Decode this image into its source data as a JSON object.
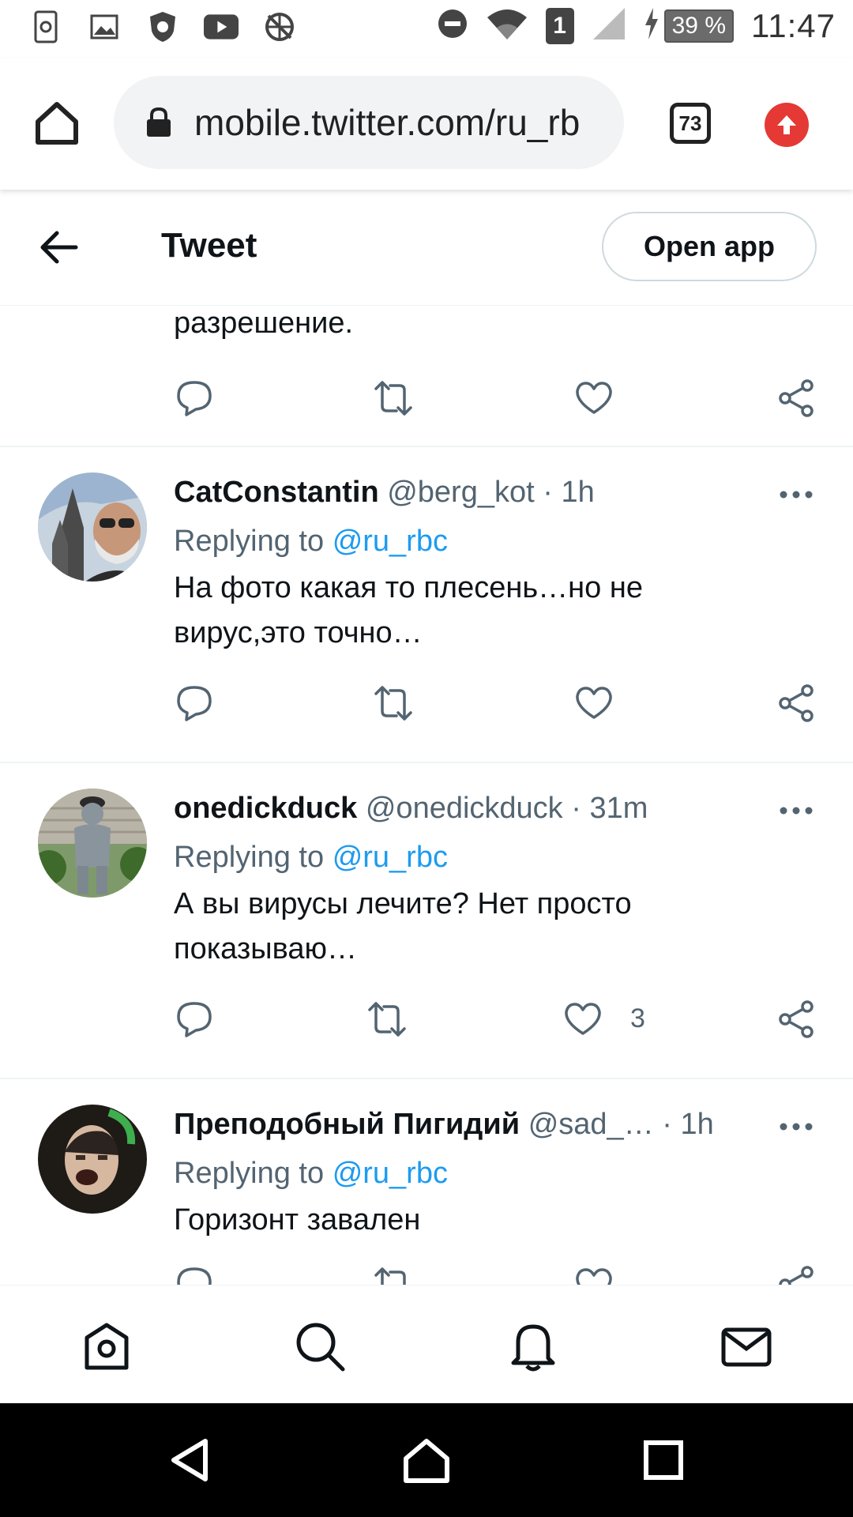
{
  "status_bar": {
    "sim_slot": "1",
    "battery": "39 %",
    "time": "11:47"
  },
  "browser": {
    "url": "mobile.twitter.com/ru_rb",
    "tab_count": "73"
  },
  "header": {
    "title": "Tweet",
    "open_app": "Open app"
  },
  "feed": {
    "partial_text": "разрешение.",
    "tweets": [
      {
        "name": "CatConstantin",
        "meta": "@berg_kot · 1h",
        "replying_prefix": "Replying to",
        "replying_to": "@ru_rbc",
        "body": "На фото какая то плесень…но не вирус,это точно…",
        "like_count": ""
      },
      {
        "name": "onedickduck",
        "meta": "@onedickduck · 31m",
        "replying_prefix": "Replying to",
        "replying_to": "@ru_rbc",
        "body": "А вы вирусы лечите? Нет просто показываю…",
        "like_count": "3"
      },
      {
        "name": "Преподобный Пигидий",
        "meta": "@sad_… · 1h",
        "replying_prefix": "Replying to",
        "replying_to": "@ru_rbc",
        "body": "Горизонт завален",
        "like_count": ""
      }
    ]
  },
  "colors": {
    "accent": "#1d9bf0",
    "secondary_text": "#536471",
    "update_badge": "#e53935"
  }
}
